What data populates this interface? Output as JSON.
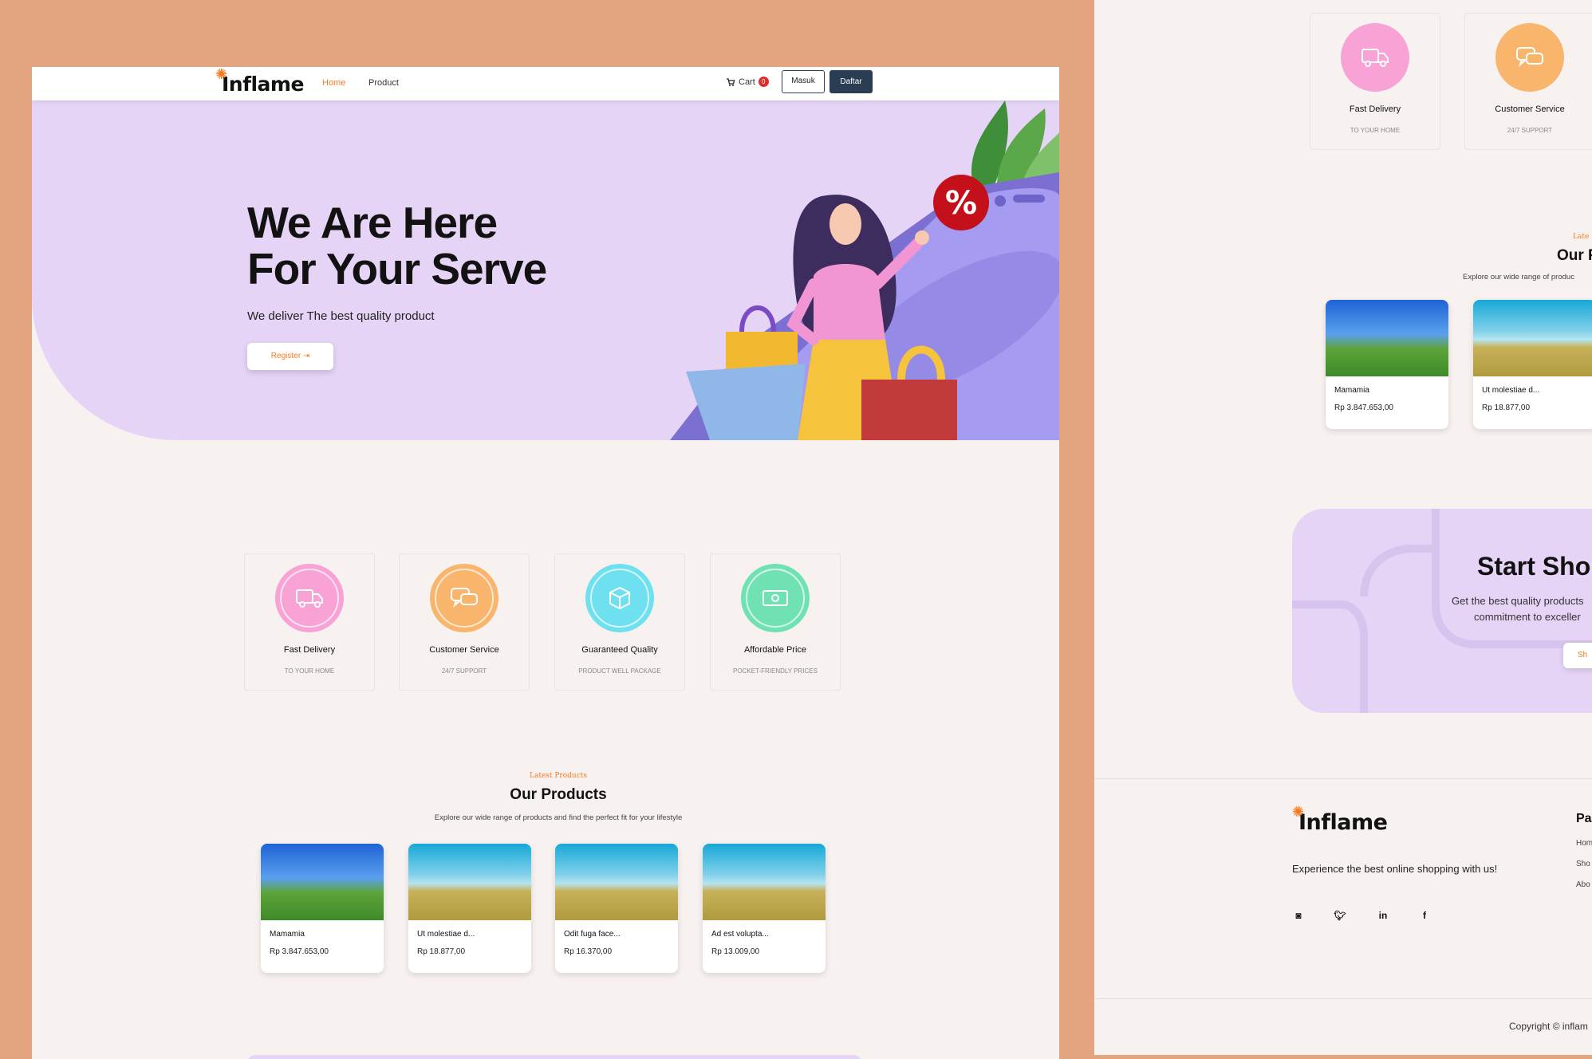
{
  "brand": {
    "name": "Inflame"
  },
  "nav": {
    "links": [
      "Home",
      "Product"
    ],
    "cart_label": "Cart",
    "cart_count": "0",
    "login_label": "Masuk",
    "signup_label": "Daftar"
  },
  "hero": {
    "title_line1": "We Are Here",
    "title_line2": "For Your Serve",
    "subtitle": "We deliver The best quality product",
    "cta": "Register",
    "discount_symbol": "%"
  },
  "features": [
    {
      "title": "Fast Delivery",
      "subtitle": "TO YOUR HOME",
      "color": "#F9A2D6",
      "icon": "truck-icon"
    },
    {
      "title": "Customer Service",
      "subtitle": "24/7 SUPPORT",
      "color": "#F9B56C",
      "icon": "chat-icon"
    },
    {
      "title": "Guaranteed Quality",
      "subtitle": "PRODUCT WELL PACKAGE",
      "color": "#6EE0EF",
      "icon": "box-icon"
    },
    {
      "title": "Affordable Price",
      "subtitle": "POCKET-FRIENDLY PRICES",
      "color": "#6FE1B2",
      "icon": "money-icon"
    }
  ],
  "products_section": {
    "kicker": "Latest Products",
    "title": "Our Products",
    "description": "Explore our wide range of products and find the perfect fit for your lifestyle"
  },
  "products": [
    {
      "name": "Mamamia",
      "price": "Rp 3.847.653,00"
    },
    {
      "name": "Ut molestiae d...",
      "price": "Rp 18.877,00"
    },
    {
      "name": "Odit fuga face...",
      "price": "Rp 16.370,00"
    },
    {
      "name": "Ad est volupta...",
      "price": "Rp 13.009,00"
    }
  ],
  "right_view": {
    "features": [
      {
        "title": "Fast Delivery",
        "subtitle": "TO YOUR HOME"
      },
      {
        "title": "Customer Service",
        "subtitle": "24/7 SUPPORT"
      }
    ],
    "section_kicker": "Late",
    "section_title": "Our P",
    "section_desc": "Explore our wide range of produc",
    "products": [
      {
        "name": "Mamamia",
        "price": "Rp 3.847.653,00"
      },
      {
        "name": "Ut molestiae d...",
        "price": "Rp 18.877,00"
      }
    ],
    "promo": {
      "title": "Start Sho",
      "line1": "Get the best quality products",
      "line2": "commitment to exceller",
      "button": "Sh"
    },
    "footer": {
      "text": "Experience the best online shopping with us!",
      "col_title": "Pa",
      "col_items": [
        "Hom",
        "Sho",
        "Abo"
      ],
      "copyright": "Copyright © inflam"
    }
  },
  "colors": {
    "accent": "#F47B20",
    "dark_button": "#2B3D52",
    "hero_bg": "#E5D4F6",
    "outer_bg": "#E3A47F",
    "page_bg": "#F7F1F0"
  }
}
